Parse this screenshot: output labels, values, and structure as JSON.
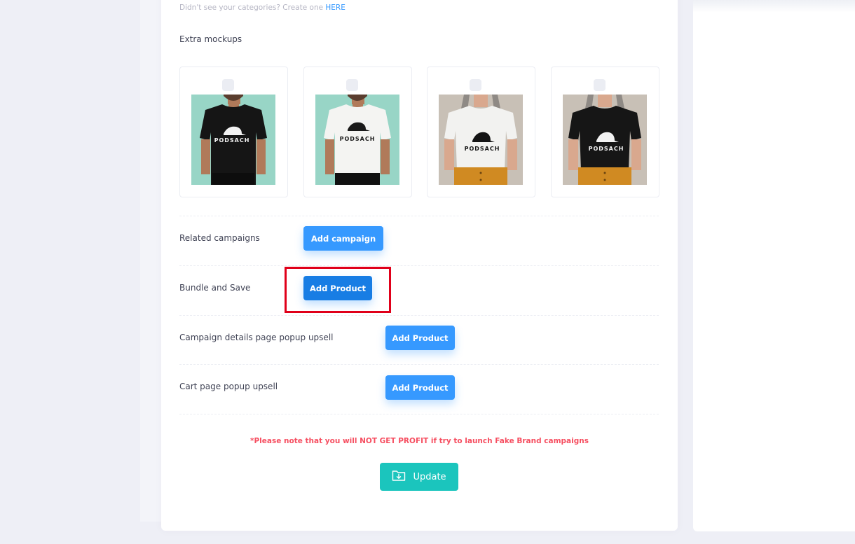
{
  "header": {
    "hint_text": "Didn't see your categories? Create one",
    "hint_link": "HERE"
  },
  "mockups": {
    "label": "Extra mockups",
    "brand": "PODSACH",
    "items": [
      {
        "shirt": "black",
        "model": "man",
        "background": "#98d5c6"
      },
      {
        "shirt": "white",
        "model": "man",
        "background": "#98d5c6"
      },
      {
        "shirt": "white",
        "model": "woman",
        "background": "#c8c0b6"
      },
      {
        "shirt": "black",
        "model": "woman",
        "background": "#c8c0b6"
      }
    ]
  },
  "rows": {
    "related_campaigns": {
      "label": "Related campaigns",
      "button": "Add campaign"
    },
    "bundle_and_save": {
      "label": "Bundle and Save",
      "button": "Add Product"
    },
    "campaign_details_upsell": {
      "label": "Campaign details page popup upsell",
      "button": "Add Product"
    },
    "cart_upsell": {
      "label": "Cart page popup upsell",
      "button": "Add Product"
    }
  },
  "note": "*Please note that you will NOT GET PROFIT if try to launch Fake Brand campaigns",
  "update": {
    "label": "Update",
    "icon": "folder-download-icon"
  },
  "colors": {
    "primary": "#3699ff",
    "primary_active": "#187de4",
    "success": "#1bc5bd",
    "danger": "#f64e60",
    "highlight": "#e0001a"
  }
}
